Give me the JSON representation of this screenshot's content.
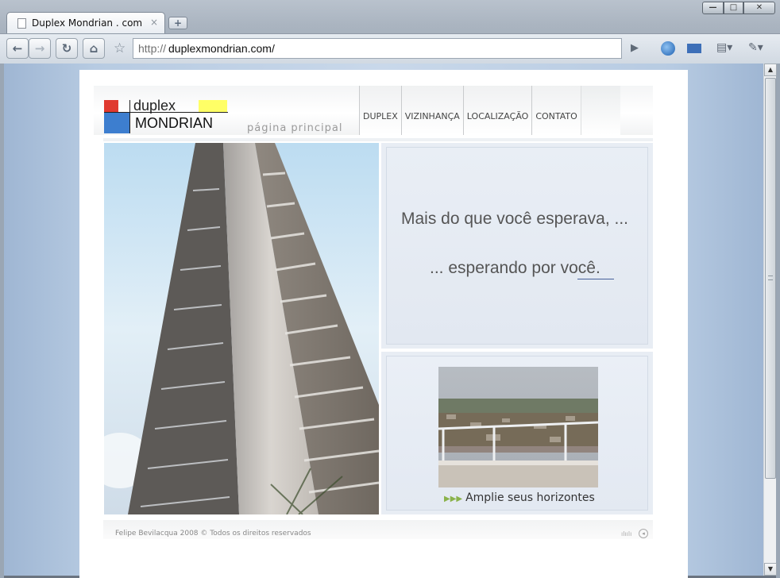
{
  "browser": {
    "tab_title": "Duplex Mondrian . com",
    "tab_close": "×",
    "new_tab": "+",
    "url_protocol": "http://",
    "url_host": "duplexmondrian.com/",
    "window_buttons": {
      "minimize": "—",
      "maximize": "□",
      "close": "✕"
    },
    "nav": {
      "back": "←",
      "forward": "→",
      "reload": "↻",
      "home": "⌂"
    },
    "star": "☆",
    "go": "▶",
    "page_menu": "▤▾",
    "tools_menu": "✎▾"
  },
  "site": {
    "logo": {
      "top": "duplex",
      "bottom": "MONDRIAN"
    },
    "subtitle": "página principal",
    "nav": [
      "DUPLEX",
      "VIZINHANÇA",
      "LOCALIZAÇÃO",
      "CONTATO"
    ],
    "quote_line1": "Mais do que você esperava, ...",
    "quote_line2": "... esperando por você.",
    "view_caption_arrows": "▶▶▶",
    "view_caption": "Amplie seus horizontes",
    "footer_text": "Felipe Bevilacqua 2008 © Todos os direitos reservados",
    "footer_eq": "ılıılı",
    "footer_sound": "◂"
  },
  "colors": {
    "mondrian_red": "#e03a30",
    "mondrian_blue": "#3d7ecf",
    "mondrian_yellow": "#ffff66",
    "accent_arrows": "#8ab24a"
  },
  "icons": [
    "page-icon",
    "globe-icon",
    "mail-icon",
    "page-menu-icon",
    "wrench-icon",
    "sound-icon",
    "equalizer-icon"
  ]
}
